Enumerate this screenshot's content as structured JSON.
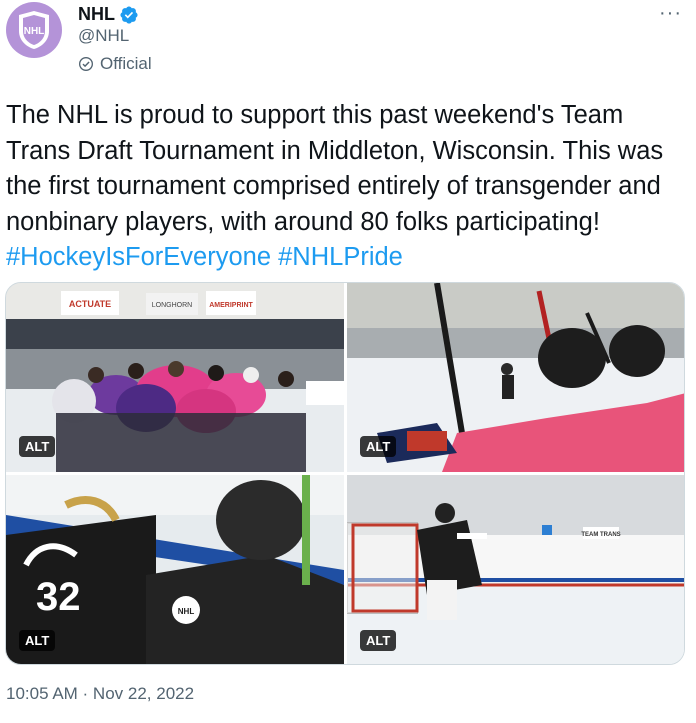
{
  "author": {
    "name": "NHL",
    "handle": "@NHL",
    "affiliation": "Official",
    "avatar_logo_text": "NHL",
    "verified": true
  },
  "more_menu_label": "···",
  "tweet": {
    "text_plain": "The NHL is proud to support this past weekend's Team Trans Draft Tournament in Middleton, Wisconsin. This was the first tournament comprised entirely of transgender and nonbinary players, with around 80 folks participating! ",
    "hashtag_1": "#HockeyIsForEveryone",
    "space": " ",
    "hashtag_2": "#NHLPride"
  },
  "media": {
    "alt_label": "ALT",
    "images": [
      {
        "alt_badge": "ALT",
        "subject": "team-group-huddle-photo",
        "signs": [
          "ACTUATE",
          "LONGHORN",
          "AMERIPRINT"
        ]
      },
      {
        "alt_badge": "ALT",
        "subject": "players-on-bench-photo"
      },
      {
        "alt_badge": "ALT",
        "subject": "players-in-helmets-photo"
      },
      {
        "alt_badge": "ALT",
        "subject": "goalie-on-ice-photo",
        "signs": [
          "TEAM TRANS"
        ]
      }
    ]
  },
  "timestamp": "10:05 AM · Nov 22, 2022",
  "colors": {
    "link": "#1d9bf0",
    "verified": "#1d9bf0",
    "avatar_bg": "#b493d8",
    "secondary_text": "#536471"
  }
}
